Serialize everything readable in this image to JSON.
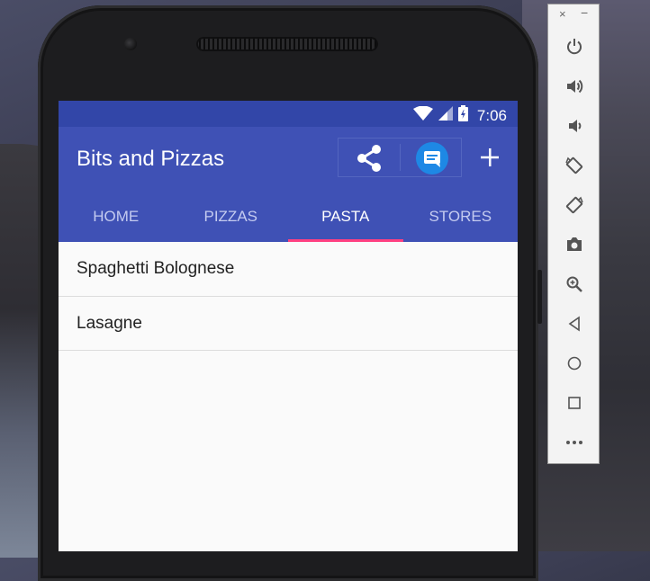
{
  "status_bar": {
    "time": "7:06"
  },
  "app_bar": {
    "title": "Bits and Pizzas",
    "accent_color": "#3f51b5",
    "status_color": "#3246a8",
    "indicator_color": "#ff4081"
  },
  "tabs": [
    {
      "label": "HOME",
      "active": false
    },
    {
      "label": "PIZZAS",
      "active": false
    },
    {
      "label": "PASTA",
      "active": true
    },
    {
      "label": "STORES",
      "active": false
    }
  ],
  "list": [
    {
      "label": "Spaghetti Bolognese"
    },
    {
      "label": "Lasagne"
    }
  ],
  "emulator": {
    "close_label": "×",
    "minimize_label": "−",
    "buttons": [
      "power-icon",
      "volume-up-icon",
      "volume-down-icon",
      "rotate-left-icon",
      "rotate-right-icon",
      "camera-icon",
      "zoom-icon",
      "back-icon",
      "home-icon",
      "overview-icon",
      "more-icon"
    ]
  }
}
